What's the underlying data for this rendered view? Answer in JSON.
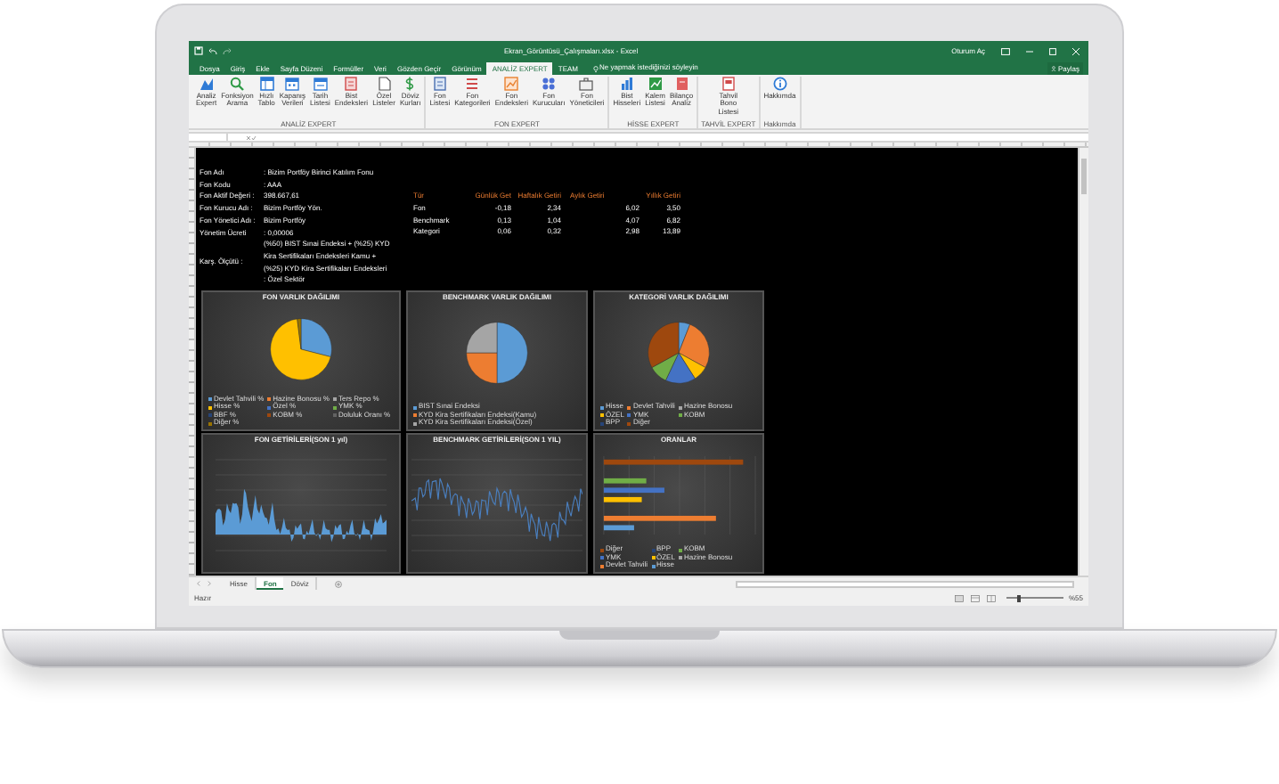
{
  "window": {
    "title": "Ekran_Görüntüsü_Çalışmaları.xlsx - Excel",
    "account": "Oturum Aç"
  },
  "tabs": [
    {
      "label": "Dosya",
      "selected": false
    },
    {
      "label": "Giriş",
      "selected": false
    },
    {
      "label": "Ekle",
      "selected": false
    },
    {
      "label": "Sayfa Düzeni",
      "selected": false
    },
    {
      "label": "Formüller",
      "selected": false
    },
    {
      "label": "Veri",
      "selected": false
    },
    {
      "label": "Gözden Geçir",
      "selected": false
    },
    {
      "label": "Görünüm",
      "selected": false
    },
    {
      "label": "ANALİZ EXPERT",
      "selected": true
    },
    {
      "label": "TEAM",
      "selected": false
    }
  ],
  "tell_me": "Ne yapmak istediğinizi söyleyin",
  "share_button": "Paylaş",
  "ribbon": {
    "groups": [
      {
        "label": "ANALİZ EXPERT",
        "buttons": [
          "Analiz Expert",
          "Fonksiyon Arama",
          "Hızlı Tablo",
          "Kapanış Verileri",
          "Tarih Listesi",
          "Bist Endeksleri",
          "Özel Listeler",
          "Döviz Kurları"
        ]
      },
      {
        "label": "FON EXPERT",
        "buttons": [
          "Fon Listesi",
          "Fon Kategorileri",
          "Fon Endeksleri",
          "Fon Kurucuları",
          "Fon Yöneticileri"
        ]
      },
      {
        "label": "HİSSE EXPERT",
        "buttons": [
          "Bist Hisseleri",
          "Kalem Listesi",
          "Bilanço Analiz"
        ]
      },
      {
        "label": "TAHVİL EXPERT",
        "buttons": [
          "Tahvil Bono Listesi"
        ]
      },
      {
        "label": "Hakkımda",
        "buttons": [
          "Hakkımda"
        ]
      }
    ]
  },
  "fund_info": [
    {
      "label": "Fon Adı",
      "value_lines": [
        ": Bizim Portföy Birinci Katılım Fonu"
      ]
    },
    {
      "label": "Fon Kodu",
      "value_lines": [
        ": AAA"
      ]
    },
    {
      "label": "Fon Aktif Değeri :",
      "value_lines": [
        "398.667,61"
      ]
    },
    {
      "label": "Fon Kurucu Adı :",
      "value_lines": [
        "Bizim Portföy Yön."
      ]
    },
    {
      "label": "Fon Yönetici Adı :",
      "value_lines": [
        "Bizim Portföy"
      ]
    },
    {
      "label": "Yönetim Ücreti",
      "value_lines": [
        ": 0,00006"
      ]
    },
    {
      "label": "Karş. Ölçütü :",
      "value_lines": [
        "(%50) BIST Sınai Endeksi + (%25) KYD",
        "Kira Sertifikaları Endeksleri Kamu +",
        "(%25) KYD Kira Sertifikaları Endeksleri",
        ": Özel Sektör"
      ]
    }
  ],
  "returns_table": {
    "columns": [
      "Tür",
      "Günlük Get",
      "Haftalık Getiri",
      "Aylık Getiri",
      "Yıllık Getiri"
    ],
    "rows": [
      [
        "Fon",
        "-0,18",
        "2,34",
        "6,02",
        "3,50"
      ],
      [
        "Benchmark",
        "0,13",
        "1,04",
        "4,07",
        "6,82"
      ],
      [
        "Kategori",
        "0,06",
        "0,32",
        "2,98",
        "13,89"
      ]
    ]
  },
  "charts": [
    {
      "kind": "pie",
      "title": "FON VARLIK DAĞILIMI",
      "legend": [
        {
          "label": "Devlet Tahvili %",
          "color": "#5b9bd5"
        },
        {
          "label": "Hazine Bonosu %",
          "color": "#ed7d31"
        },
        {
          "label": "Ters Repo %",
          "color": "#a5a5a5"
        },
        {
          "label": "Hisse %",
          "color": "#ffc000"
        },
        {
          "label": "Özel %",
          "color": "#4472c4"
        },
        {
          "label": "YMK %",
          "color": "#70ad47"
        },
        {
          "label": "BBF %",
          "color": "#264478"
        },
        {
          "label": "KOBM %",
          "color": "#9e480e"
        },
        {
          "label": "Doluluk Oranı %",
          "color": "#636363"
        },
        {
          "label": "Diğer %",
          "color": "#997300"
        }
      ]
    },
    {
      "kind": "pie",
      "title": "BENCHMARK VARLIK DAĞILIMI",
      "legend": [
        {
          "label": "BIST Sınai Endeksi",
          "color": "#5b9bd5"
        },
        {
          "label": "KYD Kira Sertifikaları Endeksi(Kamu)",
          "color": "#ed7d31"
        },
        {
          "label": "KYD Kira Sertifikaları Endeksi(Özel)",
          "color": "#a5a5a5"
        }
      ]
    },
    {
      "kind": "pie",
      "title": "KATEGORİ VARLIK DAĞILIMI",
      "legend": [
        {
          "label": "Hisse",
          "color": "#5b9bd5"
        },
        {
          "label": "Devlet Tahvili",
          "color": "#ed7d31"
        },
        {
          "label": "Hazine Bonosu",
          "color": "#a5a5a5"
        },
        {
          "label": "ÖZEL",
          "color": "#ffc000"
        },
        {
          "label": "YMK",
          "color": "#4472c4"
        },
        {
          "label": "KOBM",
          "color": "#70ad47"
        },
        {
          "label": "BPP",
          "color": "#264478"
        },
        {
          "label": "Diğer",
          "color": "#9e480e"
        }
      ]
    },
    {
      "kind": "area",
      "title": "FON GETİRİLERİ(SON 1 yıl)"
    },
    {
      "kind": "line",
      "title": "BENCHMARK GETİRİLERİ(SON 1 YIL)"
    },
    {
      "kind": "bar",
      "title": "ORANLAR",
      "legend": [
        {
          "label": "Diğer",
          "color": "#9e480e"
        },
        {
          "label": "BPP",
          "color": "#264478"
        },
        {
          "label": "KOBM",
          "color": "#70ad47"
        },
        {
          "label": "YMK",
          "color": "#4472c4"
        },
        {
          "label": "ÖZEL",
          "color": "#ffc000"
        },
        {
          "label": "Hazine Bonosu",
          "color": "#a5a5a5"
        },
        {
          "label": "Devlet Tahvili",
          "color": "#ed7d31"
        },
        {
          "label": "Hisse",
          "color": "#5b9bd5"
        }
      ]
    }
  ],
  "sheet_tabs": [
    {
      "label": "Hisse",
      "selected": false
    },
    {
      "label": "Fon",
      "selected": true
    },
    {
      "label": "Döviz",
      "selected": false
    }
  ],
  "status_bar": {
    "status": "Hazır",
    "zoom": {
      "level": 0.2,
      "reading": "%55"
    }
  }
}
